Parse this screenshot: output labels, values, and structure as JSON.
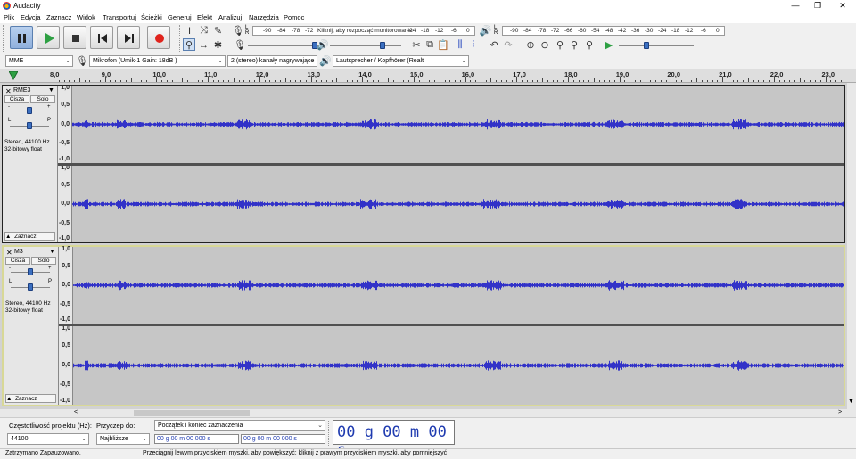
{
  "window": {
    "title": "Audacity"
  },
  "menu": [
    "Plik",
    "Edycja",
    "Zaznacz",
    "Widok",
    "Transportuj",
    "Ścieżki",
    "Generuj",
    "Efekt",
    "Analizuj",
    "Narzędzia",
    "Pomoc"
  ],
  "meters": {
    "record": {
      "channels": "L\nR",
      "hint": "Kliknij, aby rozpocząć monitorowanie",
      "scale": [
        "-90",
        "-84",
        "-78",
        "-72",
        "-24",
        "-18",
        "-12",
        "-6",
        "0"
      ]
    },
    "playback": {
      "channels": "L\nR",
      "scale": [
        "-90",
        "-84",
        "-78",
        "-72",
        "-66",
        "-60",
        "-54",
        "-48",
        "-42",
        "-36",
        "-30",
        "-24",
        "-18",
        "-12",
        "-6",
        "0"
      ]
    }
  },
  "devices": {
    "host": "MME",
    "input": "Mikrofon (Umik-1  Gain: 18dB  )",
    "channels": "2 (stereo) kanały nagrywające",
    "output": "Lautsprecher / Kopfhörer (Realt"
  },
  "timeline": {
    "ticks": [
      "8,0",
      "9,0",
      "10,0",
      "11,0",
      "12,0",
      "13,0",
      "14,0",
      "15,0",
      "16,0",
      "17,0",
      "18,0",
      "19,0",
      "20,0",
      "21,0",
      "22,0",
      "23,0"
    ]
  },
  "tracks": [
    {
      "name": "RME3",
      "mute": "Cisza",
      "solo": "Solo",
      "gain_minus": "-",
      "gain_plus": "+",
      "pan_l": "L",
      "pan_r": "P",
      "info1": "Stereo, 44100 Hz",
      "info2": "32-bitowy float",
      "collapse": "Zaznacz",
      "selected": false
    },
    {
      "name": "M3",
      "mute": "Cisza",
      "solo": "Solo",
      "gain_minus": "-",
      "gain_plus": "+",
      "pan_l": "L",
      "pan_r": "P",
      "info1": "Stereo, 44100 Hz",
      "info2": "32-bitowy float",
      "collapse": "Zaznacz",
      "selected": true
    }
  ],
  "amp_scale": [
    "1,0",
    "0,5",
    "0,0",
    "-0,5",
    "-1,0"
  ],
  "selection": {
    "rate_label": "Częstotliwość projektu (Hz):",
    "rate_value": "44100",
    "snap_label": "Przyczep do:",
    "snap_value": "Najbliższe",
    "mode": "Początek i koniec zaznaczenia",
    "start": "00 g 00 m 00 000 s",
    "end": "00 g 00 m 00 000 s",
    "audio_position": "00 g 00 m 00 s"
  },
  "status": {
    "left": "Zatrzymano Zapauzowano.",
    "hint": "Przeciągnij lewym przyciskiem myszki, aby powiększyć; kliknij z prawym przyciskiem myszki, aby pomniejszyć"
  },
  "colors": {
    "waveform": "#3232c8",
    "wave_bg": "#c6c6c6",
    "selected_border": "#d8d896",
    "play_green": "#2ea043",
    "record_red": "#e0231c"
  },
  "icons": [
    "pause-icon",
    "play-icon",
    "stop-icon",
    "skip-start-icon",
    "skip-end-icon",
    "record-icon",
    "selection-tool-icon",
    "envelope-tool-icon",
    "draw-tool-icon",
    "zoom-tool-icon",
    "timeshift-tool-icon",
    "multi-tool-icon",
    "mic-icon",
    "speaker-icon",
    "cut-icon",
    "copy-icon",
    "paste-icon",
    "trim-icon",
    "silence-icon",
    "undo-icon",
    "redo-icon",
    "zoom-in-icon",
    "zoom-out-icon",
    "fit-selection-icon",
    "fit-project-icon",
    "zoom-toggle-icon",
    "play-at-speed-icon"
  ]
}
